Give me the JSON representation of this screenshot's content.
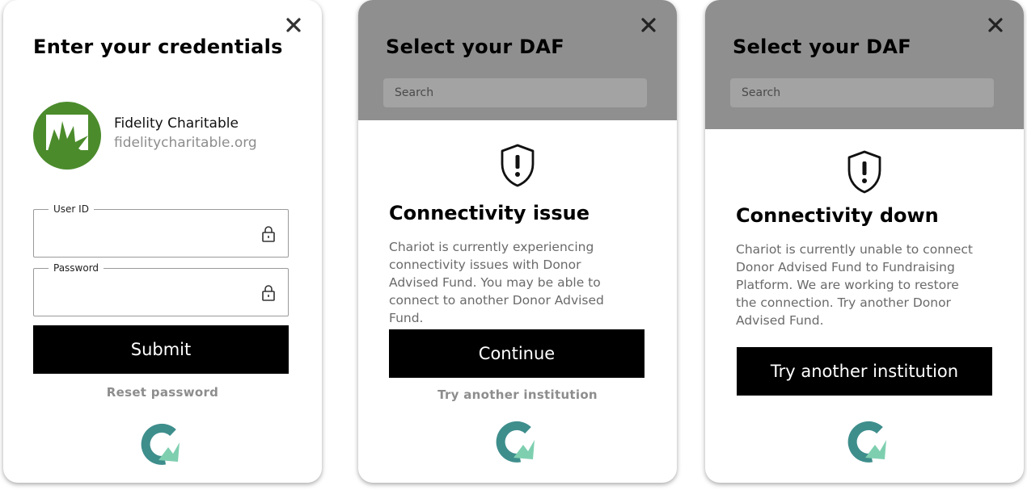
{
  "credentials_card": {
    "title": "Enter your credentials",
    "institution": {
      "name": "Fidelity Charitable",
      "url": "fidelitycharitable.org",
      "logo_color": "#4b8b2c"
    },
    "user_id_label": "User ID",
    "password_label": "Password",
    "submit_label": "Submit",
    "reset_label": "Reset password"
  },
  "issue_card": {
    "title": "Select your DAF",
    "search_placeholder": "Search",
    "heading": "Connectivity issue",
    "message": "Chariot is currently experiencing connectivity issues with Donor Advised Fund. You may be able to connect to another Donor Advised Fund.",
    "continue_label": "Continue",
    "alt_label": "Try another institution"
  },
  "down_card": {
    "title": "Select your DAF",
    "search_placeholder": "Search",
    "heading": "Connectivity down",
    "message": "Chariot is currently unable to connect Donor Advised Fund to Fundraising Platform. We are working to restore the connection. Try another Donor Advised Fund.",
    "button_label": "Try another institution"
  },
  "icons": {
    "close": "close-icon",
    "lock": "lock-icon",
    "shield": "shield-alert-icon",
    "brand": "chariot-logo"
  },
  "colors": {
    "brand_teal": "#3e8e8c",
    "brand_mint": "#7ecfb0",
    "header_gray": "#8f8f8f",
    "button_black": "#000000"
  }
}
